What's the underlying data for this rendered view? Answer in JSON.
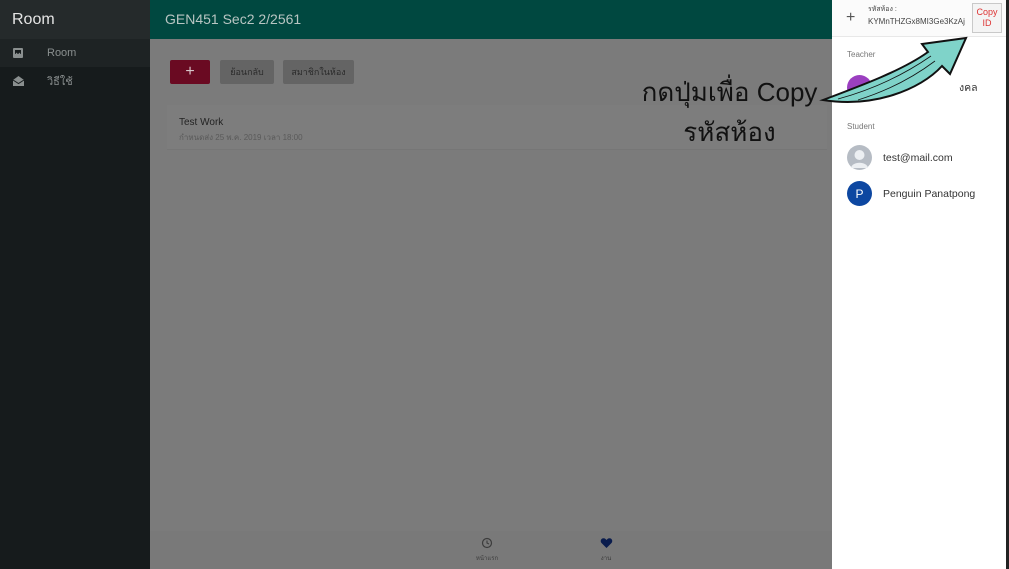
{
  "sidebar": {
    "title": "Room",
    "items": [
      {
        "label": "Room",
        "icon": "inbox-icon"
      },
      {
        "label": "วิธีใช้",
        "icon": "envelope-open-icon"
      }
    ]
  },
  "topbar": {
    "title": "GEN451 Sec2 2/2561"
  },
  "toolbar": {
    "add_label": "+",
    "back_label": "ย้อนกลับ",
    "members_label": "สมาชิกในห้อง"
  },
  "work": {
    "title": "Test Work",
    "due": "กำหนดส่ง 25 พ.ค. 2019 เวลา 18:00"
  },
  "bottom_nav": [
    {
      "label": "หน้าแรก",
      "icon": "history-icon"
    },
    {
      "label": "งาน",
      "icon": "heart-icon"
    }
  ],
  "panel": {
    "plus": "+",
    "code_label": "รหัสห้อง :",
    "code_value": "KYMnTHZGx8MI3Ge3KzAj",
    "copy_line1": "Copy",
    "copy_line2": "ID",
    "teacher_heading": "Teacher",
    "teacher_name_visible": "งคล",
    "student_heading": "Student",
    "students": [
      {
        "name": "test@mail.com",
        "avatar": ""
      },
      {
        "name": "Penguin Panatpong",
        "avatar": "P"
      }
    ]
  },
  "annotation": {
    "line1": "กดปุ่มเพื่อ Copy",
    "line2": "รหัสห้อง"
  },
  "colors": {
    "sidebar": "#161b1c",
    "topbar": "#004840",
    "add_button": "#6a0a22",
    "teacher_avatar": "#9b3fc0",
    "student_avatar_p": "#0d47a1",
    "arrow_fill": "#7fd3c9",
    "copy_text": "#dd3333"
  }
}
